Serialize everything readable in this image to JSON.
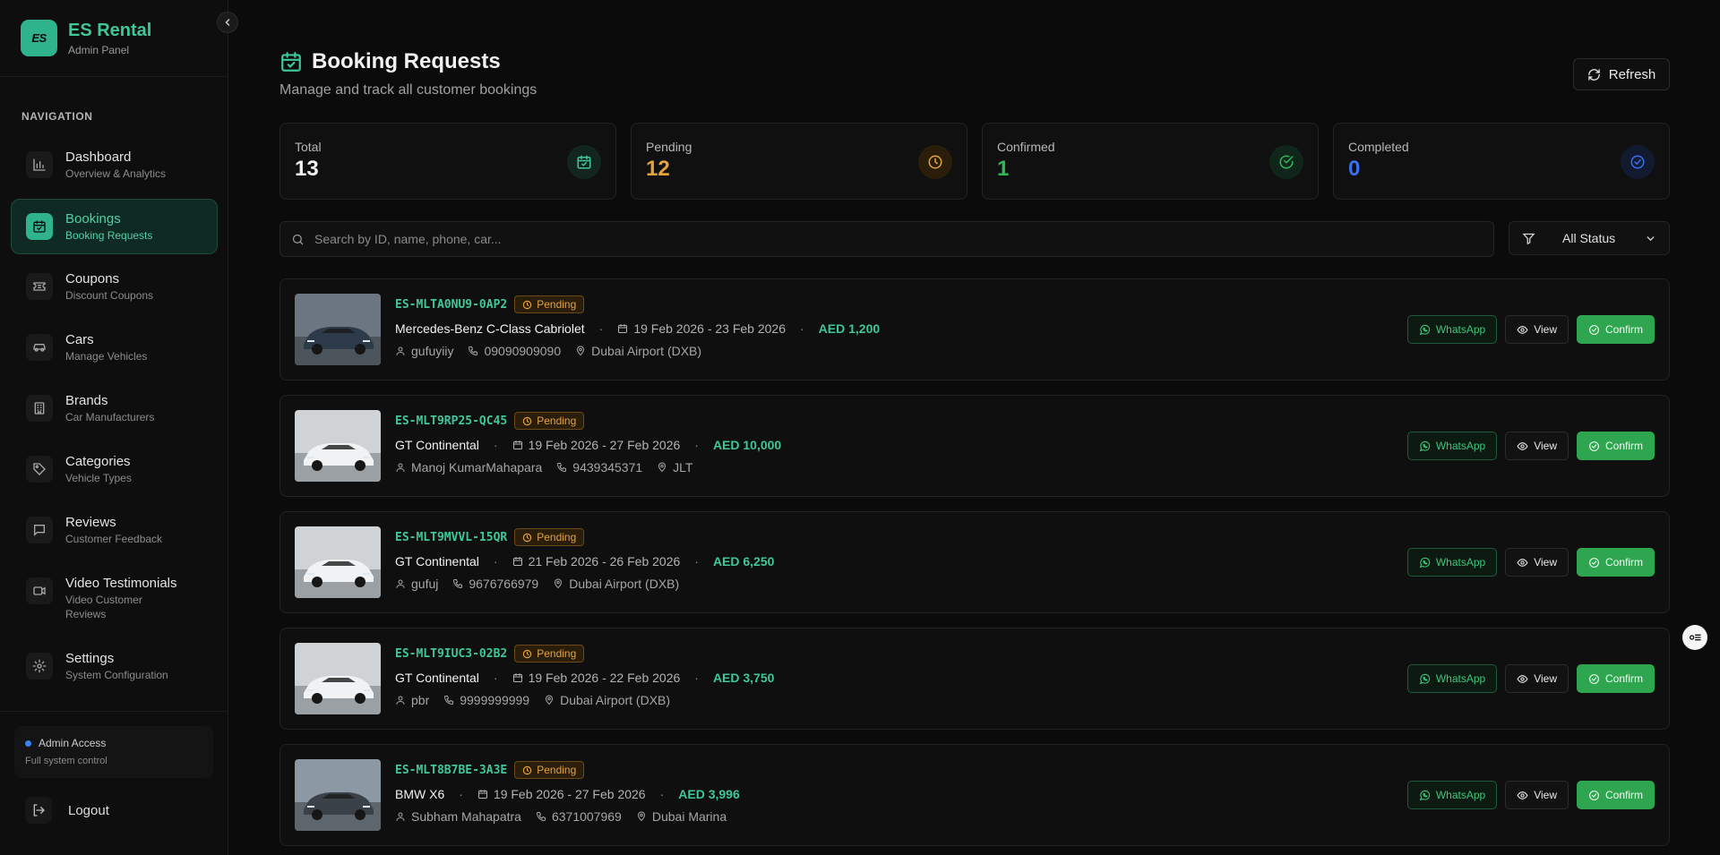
{
  "brand": {
    "logo": "ES",
    "title": "ES Rental",
    "subtitle": "Admin Panel"
  },
  "nav": {
    "heading": "NAVIGATION",
    "items": [
      {
        "label": "Dashboard",
        "desc": "Overview & Analytics",
        "icon": "bar-chart-icon"
      },
      {
        "label": "Bookings",
        "desc": "Booking Requests",
        "icon": "calendar-icon"
      },
      {
        "label": "Coupons",
        "desc": "Discount Coupons",
        "icon": "ticket-icon"
      },
      {
        "label": "Cars",
        "desc": "Manage Vehicles",
        "icon": "car-icon"
      },
      {
        "label": "Brands",
        "desc": "Car Manufacturers",
        "icon": "building-icon"
      },
      {
        "label": "Categories",
        "desc": "Vehicle Types",
        "icon": "tag-icon"
      },
      {
        "label": "Reviews",
        "desc": "Customer Feedback",
        "icon": "message-icon"
      },
      {
        "label": "Video Testimonials",
        "desc": "Video Customer Reviews",
        "icon": "video-icon"
      },
      {
        "label": "Settings",
        "desc": "System Configuration",
        "icon": "gear-icon"
      }
    ]
  },
  "admin": {
    "label": "Admin Access",
    "sub": "Full system control"
  },
  "logout": "Logout",
  "page": {
    "title": "Booking Requests",
    "subtitle": "Manage and track all customer bookings",
    "refresh": "Refresh"
  },
  "stats": [
    {
      "label": "Total",
      "value": "13",
      "color": "#f2f2f2"
    },
    {
      "label": "Pending",
      "value": "12",
      "color": "#e3a23a"
    },
    {
      "label": "Confirmed",
      "value": "1",
      "color": "#2fb85a"
    },
    {
      "label": "Completed",
      "value": "0",
      "color": "#3b6ff0"
    }
  ],
  "search": {
    "placeholder": "Search by ID, name, phone, car..."
  },
  "filter": {
    "selected": "All Status"
  },
  "actions": {
    "whatsapp": "WhatsApp",
    "view": "View",
    "confirm": "Confirm"
  },
  "bookings": [
    {
      "id": "ES-MLTA0NU9-0AP2",
      "status": "Pending",
      "car": "Mercedes-Benz C-Class Cabriolet",
      "dates": "19 Feb 2026 - 23 Feb 2026",
      "price": "AED 1,200",
      "customer": "gufuyiiy",
      "phone": "09090909090",
      "location": "Dubai Airport (DXB)"
    },
    {
      "id": "ES-MLT9RP25-QC45",
      "status": "Pending",
      "car": "GT Continental",
      "dates": "19 Feb 2026 - 27 Feb 2026",
      "price": "AED 10,000",
      "customer": "Manoj KumarMahapara",
      "phone": "9439345371",
      "location": "JLT"
    },
    {
      "id": "ES-MLT9MVVL-15QR",
      "status": "Pending",
      "car": "GT Continental",
      "dates": "21 Feb 2026 - 26 Feb 2026",
      "price": "AED 6,250",
      "customer": "gufuj",
      "phone": "9676766979",
      "location": "Dubai Airport (DXB)"
    },
    {
      "id": "ES-MLT9IUC3-02B2",
      "status": "Pending",
      "car": "GT Continental",
      "dates": "19 Feb 2026 - 22 Feb 2026",
      "price": "AED 3,750",
      "customer": "pbr",
      "phone": "9999999999",
      "location": "Dubai Airport (DXB)"
    },
    {
      "id": "ES-MLT8B7BE-3A3E",
      "status": "Pending",
      "car": "BMW X6",
      "dates": "19 Feb 2026 - 27 Feb 2026",
      "price": "AED 3,996",
      "customer": "Subham Mahapatra",
      "phone": "6371007969",
      "location": "Dubai Marina"
    }
  ]
}
